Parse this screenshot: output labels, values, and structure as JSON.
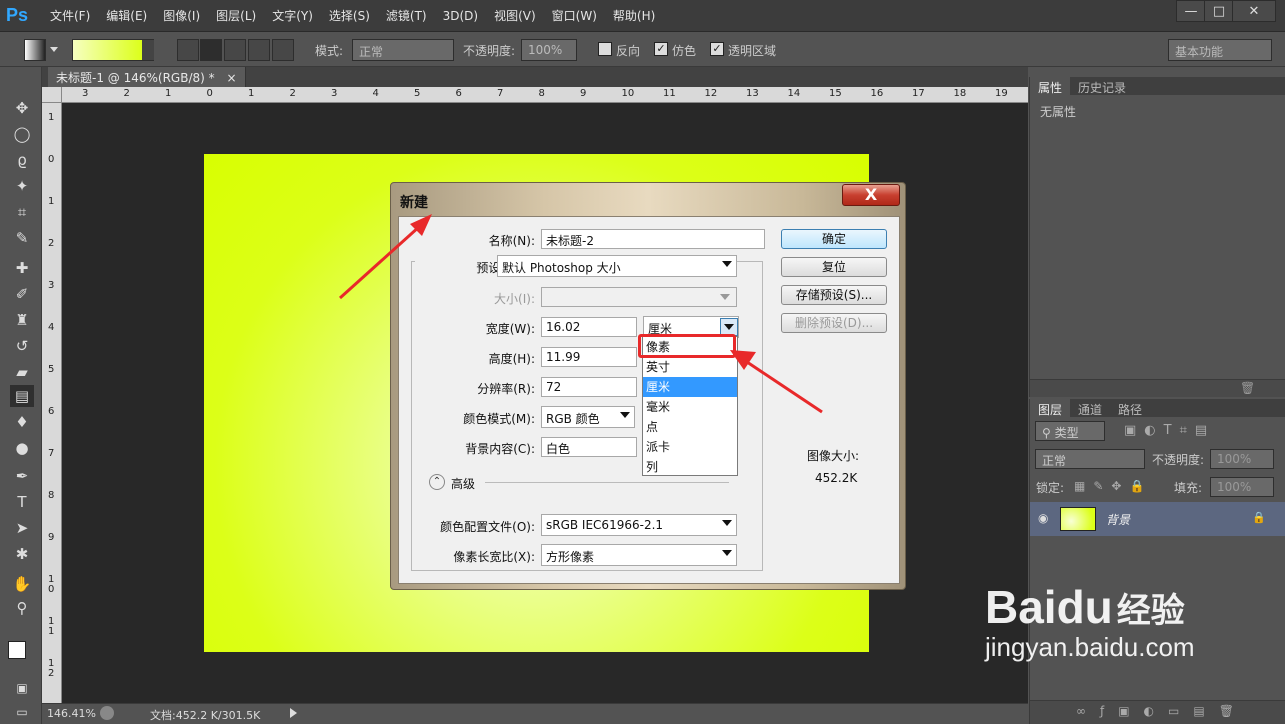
{
  "app": {
    "logo": "Ps"
  },
  "menu": [
    "文件(F)",
    "编辑(E)",
    "图像(I)",
    "图层(L)",
    "文字(Y)",
    "选择(S)",
    "滤镜(T)",
    "3D(D)",
    "视图(V)",
    "窗口(W)",
    "帮助(H)"
  ],
  "window_controls": {
    "minimize": "—",
    "restore": "□",
    "close": "✕"
  },
  "options_bar": {
    "mode_label": "模式:",
    "mode_value": "正常",
    "opacity_label": "不透明度:",
    "opacity_value": "100%",
    "reverse_label": "反向",
    "dither_label": "仿色",
    "transparency_label": "透明区域",
    "workspace": "基本功能"
  },
  "document_tab": {
    "title": "未标题-1 @ 146%(RGB/8) *",
    "close": "×"
  },
  "rulers": {
    "horizontal": [
      "3",
      "2",
      "1",
      "0",
      "1",
      "2",
      "3",
      "4",
      "5",
      "6",
      "7",
      "8",
      "9",
      "10",
      "11",
      "12",
      "13",
      "14",
      "15",
      "16",
      "17",
      "18",
      "19"
    ],
    "vertical": [
      "1",
      "0",
      "1",
      "2",
      "3",
      "4",
      "5",
      "6",
      "7",
      "8",
      "9",
      "1\n0",
      "1\n1",
      "1\n2"
    ]
  },
  "status_bar": {
    "zoom": "146.41%",
    "doc_info": "文档:452.2 K/301.5K"
  },
  "properties_panel": {
    "tabs": [
      "属性",
      "历史记录"
    ],
    "content": "无属性"
  },
  "layers_panel": {
    "tabs": [
      "图层",
      "通道",
      "路径"
    ],
    "filter_label": "类型",
    "blend_mode": "正常",
    "opacity_label": "不透明度:",
    "opacity_value": "100%",
    "lock_label": "锁定:",
    "fill_label": "填充:",
    "fill_value": "100%",
    "layers": [
      {
        "name": "背景",
        "locked": true
      }
    ]
  },
  "dialog": {
    "title": "新建",
    "close": "X",
    "name_label": "名称(N):",
    "name_value": "未标题-2",
    "preset_label": "预设(P):",
    "preset_value": "默认 Photoshop 大小",
    "size_label": "大小(I):",
    "width_label": "宽度(W):",
    "width_value": "16.02",
    "width_unit": "厘米",
    "height_label": "高度(H):",
    "height_value": "11.99",
    "resolution_label": "分辨率(R):",
    "resolution_value": "72",
    "color_mode_label": "颜色模式(M):",
    "color_mode_value": "RGB 颜色",
    "background_label": "背景内容(C):",
    "background_value": "白色",
    "advanced_label": "高级",
    "color_profile_label": "颜色配置文件(O):",
    "color_profile_value": "sRGB IEC61966-2.1",
    "pixel_aspect_label": "像素长宽比(X):",
    "pixel_aspect_value": "方形像素",
    "buttons": {
      "ok": "确定",
      "reset": "复位",
      "save_preset": "存储预设(S)...",
      "delete_preset": "删除预设(D)..."
    },
    "image_size_label": "图像大小:",
    "image_size_value": "452.2K",
    "unit_options": [
      "像素",
      "英寸",
      "厘米",
      "毫米",
      "点",
      "派卡",
      "列"
    ],
    "unit_selected": "厘米"
  },
  "watermark": {
    "brand": "Baidu",
    "brand_cn": "经验",
    "url": "jingyan.baidu.com"
  },
  "colors": {
    "accent_arrow": "#e8292a",
    "canvas_fill": "#dcff18",
    "ps_blue": "#31a8ff"
  }
}
